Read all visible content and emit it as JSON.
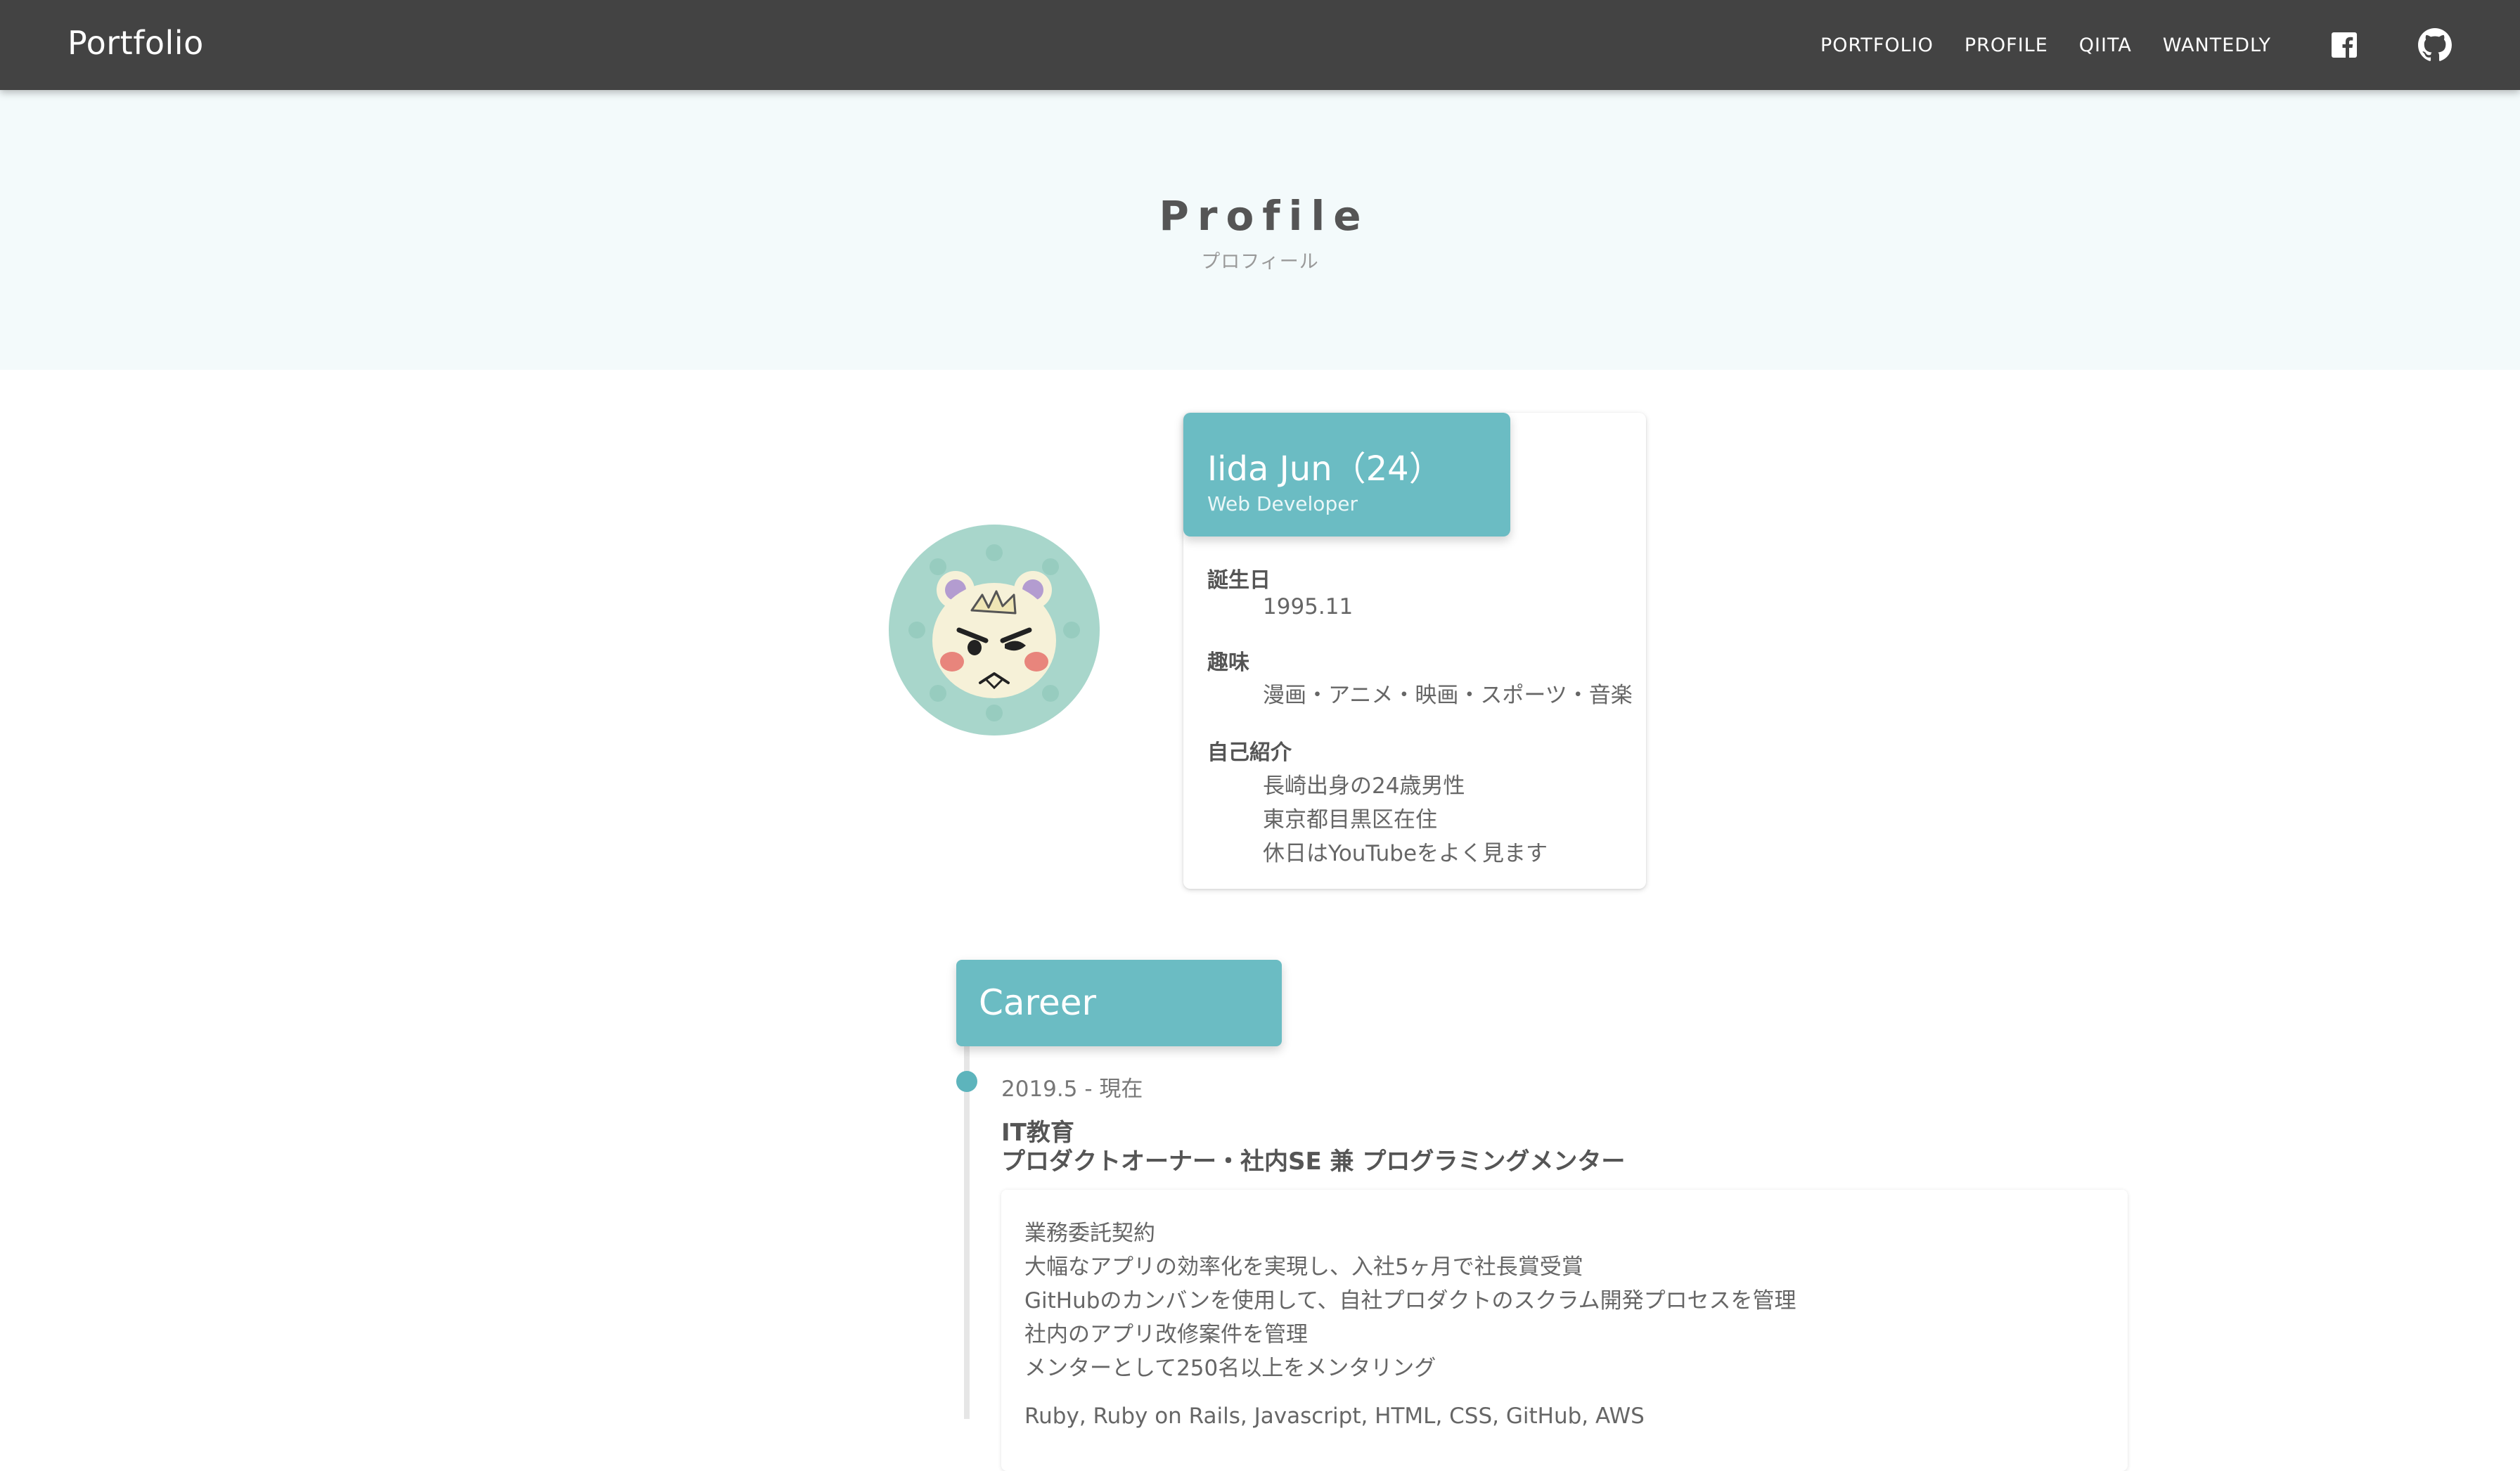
{
  "header": {
    "brand": "Portfolio",
    "nav": [
      {
        "label": "PORTFOLIO"
      },
      {
        "label": "PROFILE"
      },
      {
        "label": "QIITA"
      },
      {
        "label": "WANTEDLY"
      }
    ],
    "icons": [
      "facebook-icon",
      "github-icon"
    ]
  },
  "hero": {
    "title": "Profile",
    "subtitle": "プロフィール"
  },
  "profile": {
    "name": "Iida Jun（24）",
    "role": "Web Developer",
    "birthday_label": "誕生日",
    "birthday": "1995.11",
    "hobby_label": "趣味",
    "hobby": "漫画・アニメ・映画・スポーツ・音楽",
    "intro_label": "自己紹介",
    "intro": [
      "長崎出身の24歳男性",
      "東京都目黒区在住",
      "休日はYouTubeをよく見ます"
    ]
  },
  "career": {
    "title": "Career",
    "entries": [
      {
        "period": "2019.5 - 現在",
        "company": "IT教育",
        "position": "プロダクトオーナー・社内SE 兼 プログラミングメンター",
        "details": [
          "業務委託契約",
          "大幅なアプリの効率化を実現し、入社5ヶ月で社長賞受賞",
          "GitHubのカンバンを使用して、自社プロダクトのスクラム開発プロセスを管理",
          "社内のアプリ改修案件を管理",
          "メンターとして250名以上をメンタリング"
        ],
        "skills": "Ruby, Ruby on Rails, Javascript, HTML, CSS, GitHub, AWS"
      }
    ]
  },
  "colors": {
    "topbar": "#434343",
    "accent": "#6bbcc3",
    "hero_bg": "#f3fafb"
  }
}
